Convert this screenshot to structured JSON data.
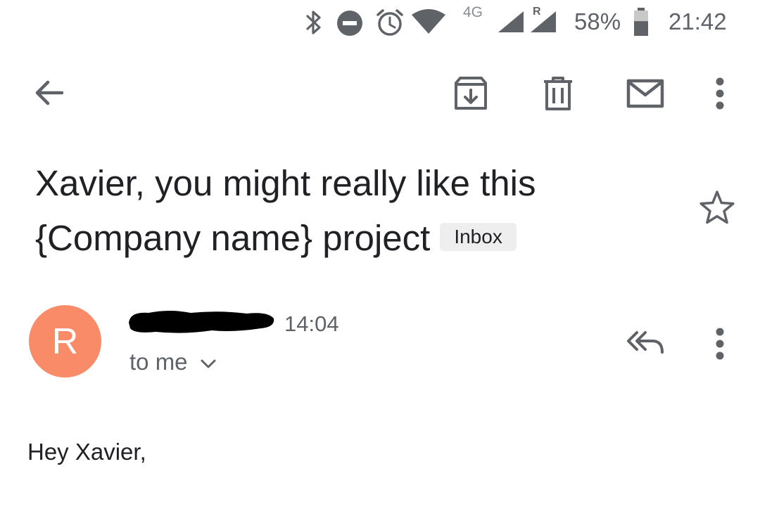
{
  "status_bar": {
    "network_label": "4G",
    "roaming_label": "R",
    "battery_percent": "58%",
    "battery_level": 0.58,
    "time": "21:42",
    "icons": [
      "bluetooth-icon",
      "do-not-disturb-icon",
      "alarm-icon",
      "wifi-icon",
      "signal-icon",
      "roaming-signal-icon",
      "battery-icon"
    ]
  },
  "toolbar": {
    "icons": [
      "back-arrow-icon",
      "archive-icon",
      "delete-icon",
      "mark-unread-icon",
      "more-vert-icon"
    ]
  },
  "email": {
    "subject_line1": "Xavier, you might really like this",
    "subject_line2": "{Company name} project",
    "label_chip": "Inbox",
    "sender_initial": "R",
    "avatar_color": "#f98b68",
    "time": "14:04",
    "recipients": "to me",
    "body_greeting": "Hey Xavier,"
  },
  "colors": {
    "icon_gray": "#5f6368",
    "text_primary": "#202124",
    "chip_bg": "#eeeeee"
  }
}
